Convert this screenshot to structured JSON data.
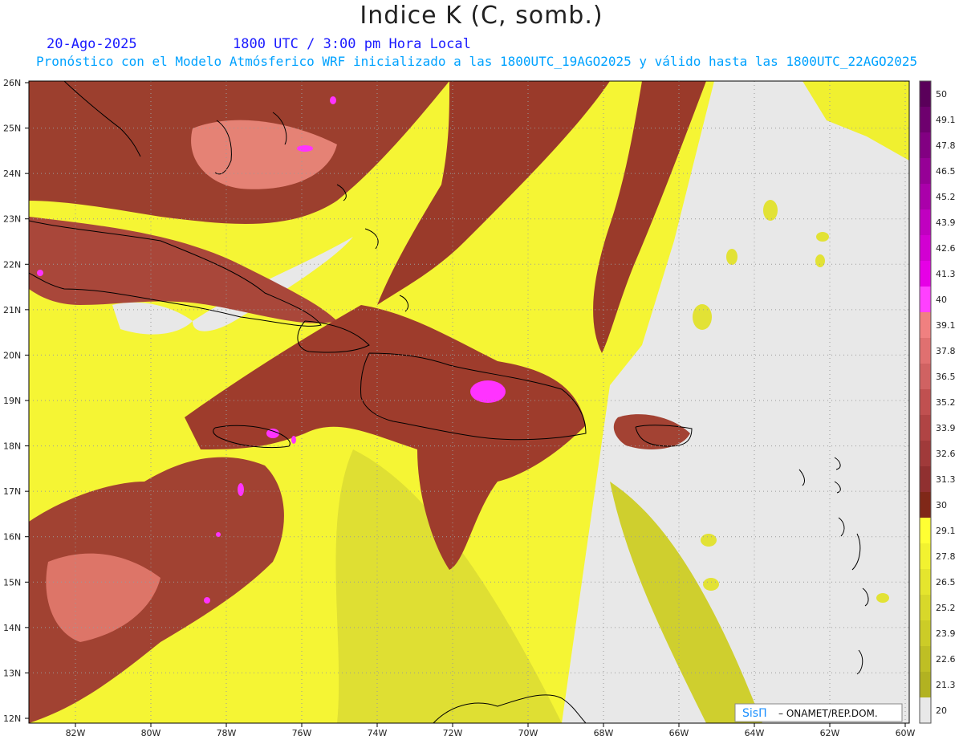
{
  "header": {
    "title": "Indice K (C, somb.)",
    "date": "20-Ago-2025",
    "time": "1800 UTC / 3:00 pm Hora Local",
    "model_line": "Pronóstico con el Modelo Atmósferico WRF inicializado a las 1800UTC_19AGO2025 y válido hasta las  1800UTC_22AGO2025"
  },
  "map": {
    "lat_labels": [
      "26N",
      "25N",
      "24N",
      "23N",
      "22N",
      "21N",
      "20N",
      "19N",
      "18N",
      "17N",
      "16N",
      "15N",
      "14N",
      "13N",
      "12N"
    ],
    "lon_labels": [
      "82W",
      "80W",
      "78W",
      "76W",
      "74W",
      "72W",
      "70W",
      "68W",
      "66W",
      "64W",
      "62W",
      "60W"
    ],
    "grid": "dotted",
    "background_color": "#e8e8e8"
  },
  "colorbar": {
    "labels": [
      "50",
      "49.1",
      "47.8",
      "46.5",
      "45.2",
      "43.9",
      "42.6",
      "41.3",
      "40",
      "39.1",
      "37.8",
      "36.5",
      "35.2",
      "33.9",
      "32.6",
      "31.3",
      "30",
      "29.1",
      "27.8",
      "26.5",
      "25.2",
      "23.9",
      "22.6",
      "21.3",
      "20"
    ],
    "colors": [
      "#5a005a",
      "#6e006e",
      "#820082",
      "#960096",
      "#aa00aa",
      "#c000c0",
      "#d200d2",
      "#e600e6",
      "#ff40ff",
      "#f08080",
      "#e07070",
      "#d06262",
      "#c05050",
      "#b04444",
      "#a03a3a",
      "#903030",
      "#802818",
      "#ffff33",
      "#f2f230",
      "#e5e52d",
      "#d8d82a",
      "#cccc27",
      "#bfbf24",
      "#b2b221",
      "#e8e8e8"
    ]
  },
  "footer": {
    "logo_text": "SisΠ",
    "credit": "– ONAMET/REP.DOM."
  }
}
